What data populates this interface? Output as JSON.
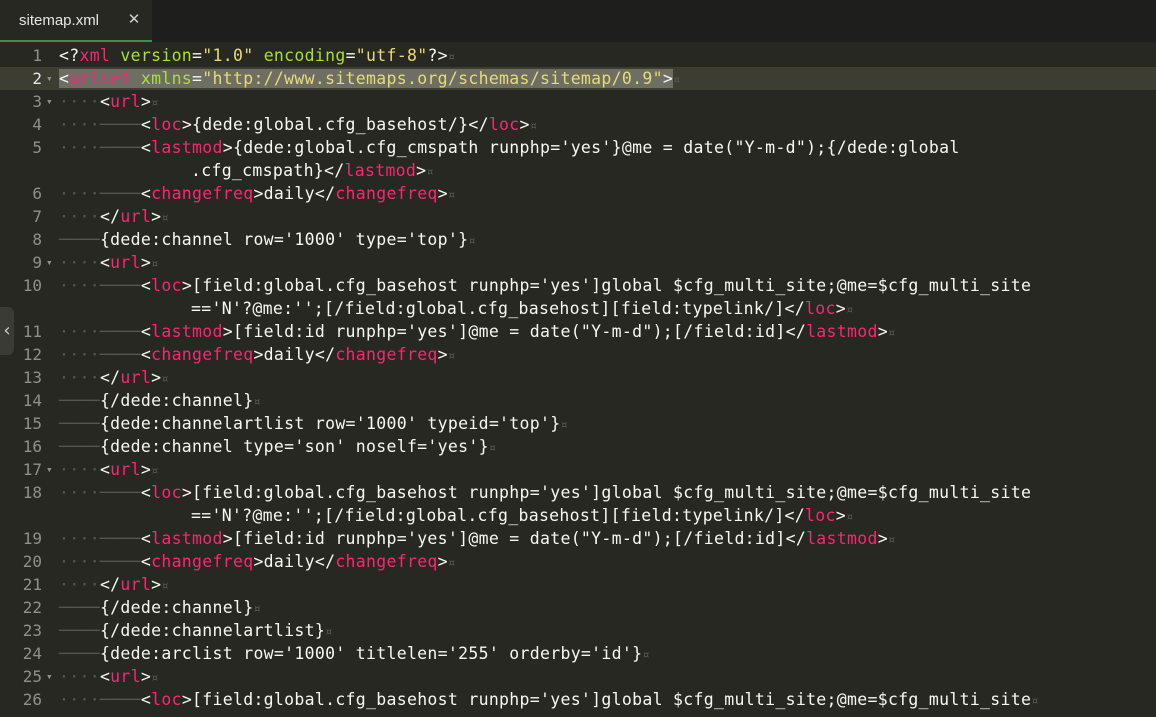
{
  "tab": {
    "title": "sitemap.xml",
    "close_glyph": "✕",
    "close_icon": "close-icon"
  },
  "sidebar_toggle": {
    "glyph": "‹",
    "icon": "chevron-left-icon"
  },
  "colors": {
    "background": "#272822",
    "tag": "#f92672",
    "attribute": "#a6e22e",
    "string": "#e6db74",
    "text": "#f8f8f2",
    "line_number": "#8f908a",
    "active_tab_underline": "#3d8d4f"
  },
  "lines": [
    {
      "n": "1",
      "fold": "",
      "ws": "",
      "segs": [
        [
          "p",
          "<?"
        ],
        [
          "t",
          "xml"
        ],
        [
          "p",
          " "
        ],
        [
          "a",
          "version"
        ],
        [
          "p",
          "="
        ],
        [
          "s",
          "\"1.0\""
        ],
        [
          "p",
          " "
        ],
        [
          "a",
          "encoding"
        ],
        [
          "p",
          "="
        ],
        [
          "s",
          "\"utf-8\""
        ],
        [
          "p",
          "?>"
        ]
      ]
    },
    {
      "n": "2",
      "fold": "▾",
      "ws": "",
      "current": true,
      "segs": [
        [
          "p",
          "<"
        ],
        [
          "t",
          "urlset"
        ],
        [
          "p",
          " "
        ],
        [
          "a",
          "xmlns"
        ],
        [
          "p",
          "="
        ],
        [
          "s",
          "\"http://www.sitemaps.org/schemas/sitemap/0.9\""
        ],
        [
          "p",
          ">"
        ]
      ]
    },
    {
      "n": "3",
      "fold": "▾",
      "ws": "····",
      "segs": [
        [
          "p",
          "<"
        ],
        [
          "t",
          "url"
        ],
        [
          "p",
          ">"
        ]
      ]
    },
    {
      "n": "4",
      "fold": "",
      "ws": "····\t",
      "segs": [
        [
          "p",
          "<"
        ],
        [
          "t",
          "loc"
        ],
        [
          "p",
          ">{dede:global.cfg_basehost/}</"
        ],
        [
          "t",
          "loc"
        ],
        [
          "p",
          ">"
        ]
      ]
    },
    {
      "n": "5",
      "fold": "",
      "ws": "····\t",
      "segs": [
        [
          "p",
          "<"
        ],
        [
          "t",
          "lastmod"
        ],
        [
          "p",
          ">{dede:global.cfg_cmspath runphp='yes'}@me = date(\"Y-m-d\");{/dede:global"
        ]
      ]
    },
    {
      "n": "",
      "fold": "",
      "ws": "",
      "wrap": true,
      "segs": [
        [
          "p",
          ".cfg_cmspath}</"
        ],
        [
          "t",
          "lastmod"
        ],
        [
          "p",
          ">"
        ]
      ]
    },
    {
      "n": "6",
      "fold": "",
      "ws": "····\t",
      "segs": [
        [
          "p",
          "<"
        ],
        [
          "t",
          "changefreq"
        ],
        [
          "p",
          ">daily</"
        ],
        [
          "t",
          "changefreq"
        ],
        [
          "p",
          ">"
        ]
      ]
    },
    {
      "n": "7",
      "fold": "",
      "ws": "····",
      "segs": [
        [
          "p",
          "</"
        ],
        [
          "t",
          "url"
        ],
        [
          "p",
          ">"
        ]
      ]
    },
    {
      "n": "8",
      "fold": "",
      "ws": "\t",
      "segs": [
        [
          "p",
          "{dede:channel row='1000' type='top'}"
        ]
      ]
    },
    {
      "n": "9",
      "fold": "▾",
      "ws": "····",
      "segs": [
        [
          "p",
          "<"
        ],
        [
          "t",
          "url"
        ],
        [
          "p",
          ">"
        ]
      ]
    },
    {
      "n": "10",
      "fold": "",
      "ws": "····\t",
      "segs": [
        [
          "p",
          "<"
        ],
        [
          "t",
          "loc"
        ],
        [
          "p",
          ">[field:global.cfg_basehost runphp='yes']global $cfg_multi_site;@me=$cfg_multi_site"
        ]
      ]
    },
    {
      "n": "",
      "fold": "",
      "ws": "",
      "wrap": true,
      "segs": [
        [
          "p",
          "=='N'?@me:'';[/field:global.cfg_basehost][field:typelink/]</"
        ],
        [
          "t",
          "loc"
        ],
        [
          "p",
          ">"
        ]
      ]
    },
    {
      "n": "11",
      "fold": "",
      "ws": "····\t",
      "segs": [
        [
          "p",
          "<"
        ],
        [
          "t",
          "lastmod"
        ],
        [
          "p",
          ">[field:id runphp='yes']@me = date(\"Y-m-d\");[/field:id]</"
        ],
        [
          "t",
          "lastmod"
        ],
        [
          "p",
          ">"
        ]
      ]
    },
    {
      "n": "12",
      "fold": "",
      "ws": "····\t",
      "segs": [
        [
          "p",
          "<"
        ],
        [
          "t",
          "changefreq"
        ],
        [
          "p",
          ">daily</"
        ],
        [
          "t",
          "changefreq"
        ],
        [
          "p",
          ">"
        ]
      ]
    },
    {
      "n": "13",
      "fold": "",
      "ws": "····",
      "segs": [
        [
          "p",
          "</"
        ],
        [
          "t",
          "url"
        ],
        [
          "p",
          ">"
        ]
      ]
    },
    {
      "n": "14",
      "fold": "",
      "ws": "\t",
      "segs": [
        [
          "p",
          "{/dede:channel}"
        ]
      ]
    },
    {
      "n": "15",
      "fold": "",
      "ws": "\t",
      "segs": [
        [
          "p",
          "{dede:channelartlist row='1000' typeid='top'}"
        ]
      ]
    },
    {
      "n": "16",
      "fold": "",
      "ws": "\t",
      "segs": [
        [
          "p",
          "{dede:channel type='son' noself='yes'}"
        ]
      ]
    },
    {
      "n": "17",
      "fold": "▾",
      "ws": "····",
      "segs": [
        [
          "p",
          "<"
        ],
        [
          "t",
          "url"
        ],
        [
          "p",
          ">"
        ]
      ]
    },
    {
      "n": "18",
      "fold": "",
      "ws": "····\t",
      "segs": [
        [
          "p",
          "<"
        ],
        [
          "t",
          "loc"
        ],
        [
          "p",
          ">[field:global.cfg_basehost runphp='yes']global $cfg_multi_site;@me=$cfg_multi_site"
        ]
      ]
    },
    {
      "n": "",
      "fold": "",
      "ws": "",
      "wrap": true,
      "segs": [
        [
          "p",
          "=='N'?@me:'';[/field:global.cfg_basehost][field:typelink/]</"
        ],
        [
          "t",
          "loc"
        ],
        [
          "p",
          ">"
        ]
      ]
    },
    {
      "n": "19",
      "fold": "",
      "ws": "····\t",
      "segs": [
        [
          "p",
          "<"
        ],
        [
          "t",
          "lastmod"
        ],
        [
          "p",
          ">[field:id runphp='yes']@me = date(\"Y-m-d\");[/field:id]</"
        ],
        [
          "t",
          "lastmod"
        ],
        [
          "p",
          ">"
        ]
      ]
    },
    {
      "n": "20",
      "fold": "",
      "ws": "····\t",
      "segs": [
        [
          "p",
          "<"
        ],
        [
          "t",
          "changefreq"
        ],
        [
          "p",
          ">daily</"
        ],
        [
          "t",
          "changefreq"
        ],
        [
          "p",
          ">"
        ]
      ]
    },
    {
      "n": "21",
      "fold": "",
      "ws": "····",
      "segs": [
        [
          "p",
          "</"
        ],
        [
          "t",
          "url"
        ],
        [
          "p",
          ">"
        ]
      ]
    },
    {
      "n": "22",
      "fold": "",
      "ws": "\t",
      "segs": [
        [
          "p",
          "{/dede:channel}"
        ]
      ]
    },
    {
      "n": "23",
      "fold": "",
      "ws": "\t",
      "segs": [
        [
          "p",
          "{/dede:channelartlist}"
        ]
      ]
    },
    {
      "n": "24",
      "fold": "",
      "ws": "\t",
      "segs": [
        [
          "p",
          "{dede:arclist row='1000' titlelen='255' orderby='id'}"
        ]
      ]
    },
    {
      "n": "25",
      "fold": "▾",
      "ws": "····",
      "segs": [
        [
          "p",
          "<"
        ],
        [
          "t",
          "url"
        ],
        [
          "p",
          ">"
        ]
      ]
    },
    {
      "n": "26",
      "fold": "",
      "ws": "····\t",
      "segs": [
        [
          "p",
          "<"
        ],
        [
          "t",
          "loc"
        ],
        [
          "p",
          ">[field:global.cfg_basehost runphp='yes']global $cfg_multi_site;@me=$cfg_multi_site"
        ]
      ]
    }
  ]
}
